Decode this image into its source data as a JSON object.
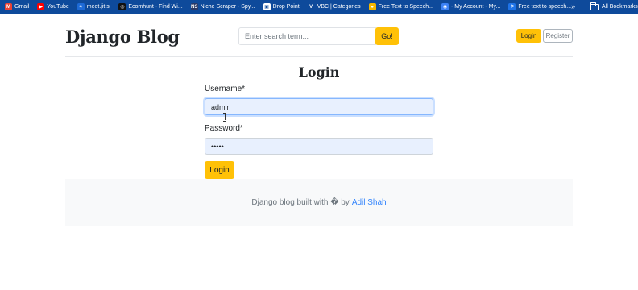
{
  "bookmarks": {
    "items": [
      {
        "label": "Gmail",
        "icon": "gmail-icon",
        "color": "#ea4335",
        "glyph": "M"
      },
      {
        "label": "YouTube",
        "icon": "youtube-icon",
        "color": "#ff0000",
        "glyph": "▶"
      },
      {
        "label": "meet.jit.si",
        "icon": "jitsi-icon",
        "color": "#1d6ad6",
        "glyph": "≈"
      },
      {
        "label": "Ecomhunt - Find Wi...",
        "icon": "ecomhunt-icon",
        "color": "#111111",
        "glyph": "◎"
      },
      {
        "label": "Niche Scraper - Spy...",
        "icon": "niche-scraper-icon",
        "color": "#2b3a67",
        "glyph": "NS"
      },
      {
        "label": "Drop Point",
        "icon": "drop-point-icon",
        "color": "#ffffff",
        "glyph": "▣"
      },
      {
        "label": "VBC | Categories",
        "icon": "vbc-icon",
        "color": "#0e4a9b",
        "glyph": "V"
      },
      {
        "label": "Free Text to Speech...",
        "icon": "tts-icon",
        "color": "#f5b800",
        "glyph": "●"
      },
      {
        "label": "- My Account - My...",
        "icon": "account-icon",
        "color": "#3b82f6",
        "glyph": "◉"
      },
      {
        "label": "Free text to speech...",
        "icon": "speech-icon",
        "color": "#1e73e8",
        "glyph": "⚑"
      }
    ],
    "more": "»",
    "all_bookmarks": "All Bookmarks"
  },
  "header": {
    "brand": "Django Blog",
    "search_placeholder": "Enter search term...",
    "search_button": "Go!",
    "login_button": "Login",
    "register_button": "Register"
  },
  "form": {
    "title": "Login",
    "username_label": "Username*",
    "username_value": "admin",
    "password_label": "Password*",
    "password_value": "•••••",
    "submit_label": "Login"
  },
  "footer": {
    "text": "Django blog built with � by",
    "author": "Adil Shah"
  },
  "colors": {
    "accent": "#ffc107",
    "bookmarks_bar": "#0e4a9b",
    "link": "#0d6efd",
    "autofill": "#e8f0fe"
  }
}
